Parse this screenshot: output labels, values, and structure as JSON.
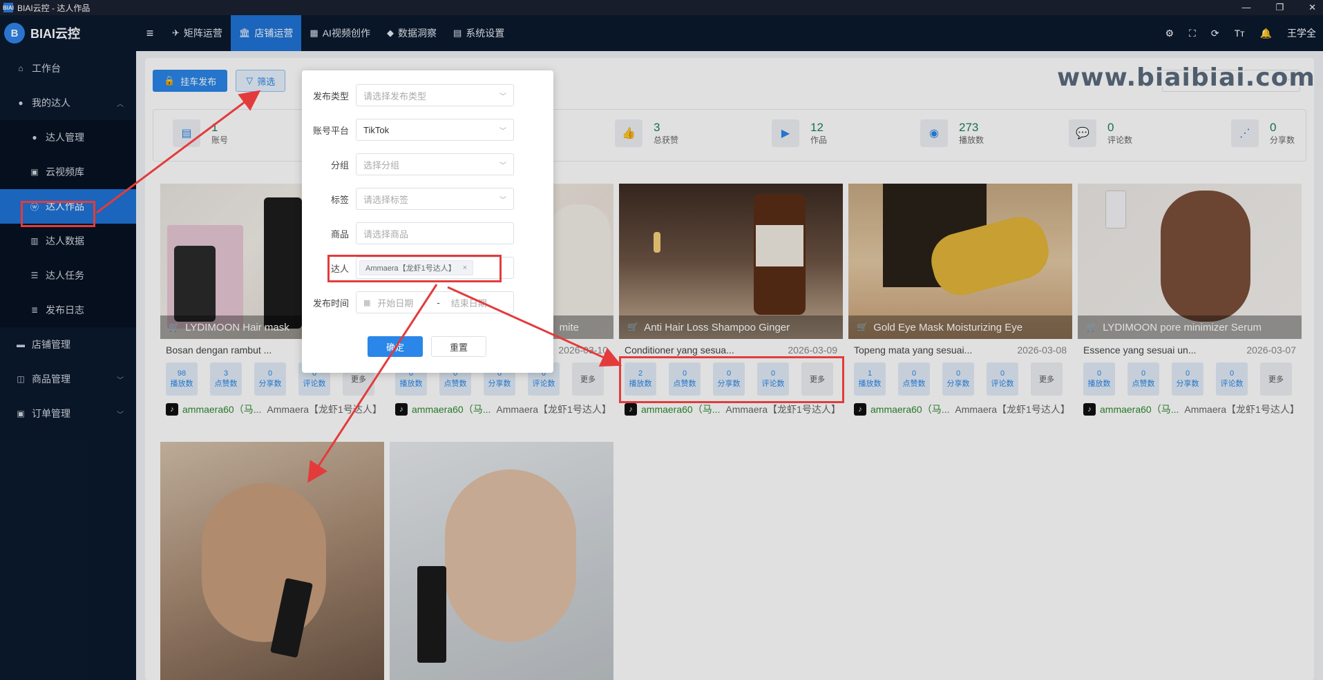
{
  "window": {
    "title": "BIAI云控 - 达人作品",
    "icon_text": "BIAI",
    "minimize": "—",
    "maximize": "❐",
    "close": "✕"
  },
  "brand": {
    "name": "BIAI云控",
    "mark": "B"
  },
  "sidebar": {
    "items": [
      {
        "label": "工作台",
        "icon": "desktop-icon"
      },
      {
        "label": "我的达人",
        "icon": "user-icon",
        "expanded": true
      },
      {
        "label": "达人管理",
        "icon": "user-icon"
      },
      {
        "label": "云视频库",
        "icon": "video-library-icon"
      },
      {
        "label": "达人作品",
        "icon": "wordpress-icon",
        "active": true
      },
      {
        "label": "达人数据",
        "icon": "bar-chart-icon"
      },
      {
        "label": "达人任务",
        "icon": "task-icon"
      },
      {
        "label": "发布日志",
        "icon": "list-icon"
      },
      {
        "label": "店铺管理",
        "icon": "store-icon"
      },
      {
        "label": "商品管理",
        "icon": "bag-icon"
      },
      {
        "label": "订单管理",
        "icon": "lock-icon"
      }
    ]
  },
  "topnav": {
    "tabs": [
      {
        "label": "矩阵运营",
        "icon": "✈"
      },
      {
        "label": "店铺运营",
        "icon": "🏛",
        "active": true
      },
      {
        "label": "AI视频创作",
        "icon": "▦"
      },
      {
        "label": "数据洞察",
        "icon": "◆"
      },
      {
        "label": "系统设置",
        "icon": "▤"
      }
    ],
    "user": "王学全"
  },
  "toolbar": {
    "publish_label": "挂车发布",
    "filter_label": "筛选"
  },
  "watermark": "www.biaibiai.com",
  "stats": [
    {
      "value": "1",
      "label": "账号"
    },
    {
      "value": "3",
      "label": "总获赞"
    },
    {
      "value": "12",
      "label": "作品"
    },
    {
      "value": "273",
      "label": "播放数"
    },
    {
      "value": "0",
      "label": "评论数"
    },
    {
      "value": "0",
      "label": "分享数"
    }
  ],
  "metric_labels": [
    "播放数",
    "点赞数",
    "分享数",
    "评论数"
  ],
  "more_label": "更多",
  "cards": [
    {
      "product": "LYDIMOON Hair mask",
      "title": "Bosan dengan rambut ...",
      "date": "",
      "metrics": [
        "98",
        "3",
        "0",
        "0"
      ],
      "handle": "ammaera60（马...",
      "alias": "Ammaera【龙虾1号达人】"
    },
    {
      "product": "mite",
      "title": "",
      "date": "2026-03-10",
      "metrics": [
        "0",
        "0",
        "0",
        "0"
      ],
      "handle": "ammaera60（马...",
      "alias": "Ammaera【龙虾1号达人】"
    },
    {
      "product": "Anti Hair Loss Shampoo Ginger",
      "title": "Conditioner yang sesua...",
      "date": "2026-03-09",
      "metrics": [
        "2",
        "0",
        "0",
        "0"
      ],
      "handle": "ammaera60（马...",
      "alias": "Ammaera【龙虾1号达人】"
    },
    {
      "product": "Gold Eye Mask Moisturizing Eye",
      "title": "Topeng mata yang sesuai...",
      "date": "2026-03-08",
      "metrics": [
        "1",
        "0",
        "0",
        "0"
      ],
      "handle": "ammaera60（马...",
      "alias": "Ammaera【龙虾1号达人】"
    },
    {
      "product": "LYDIMOON pore minimizer Serum",
      "title": "Essence yang sesuai un...",
      "date": "2026-03-07",
      "metrics": [
        "0",
        "0",
        "0",
        "0"
      ],
      "handle": "ammaera60（马...",
      "alias": "Ammaera【龙虾1号达人】"
    }
  ],
  "filter": {
    "fields": [
      {
        "label": "发布类型",
        "placeholder": "请选择发布类型",
        "value": ""
      },
      {
        "label": "账号平台",
        "placeholder": "",
        "value": "TikTok"
      },
      {
        "label": "分组",
        "placeholder": "选择分组",
        "value": ""
      },
      {
        "label": "标签",
        "placeholder": "请选择标签",
        "value": ""
      },
      {
        "label": "商品",
        "placeholder": "请选择商品",
        "value": ""
      }
    ],
    "creator_label": "达人",
    "creator_tag": "Ammaera【龙虾1号达人】",
    "time_label": "发布时间",
    "start_placeholder": "开始日期",
    "range_sep": "-",
    "end_placeholder": "结束日期",
    "confirm": "确定",
    "reset": "重置"
  }
}
